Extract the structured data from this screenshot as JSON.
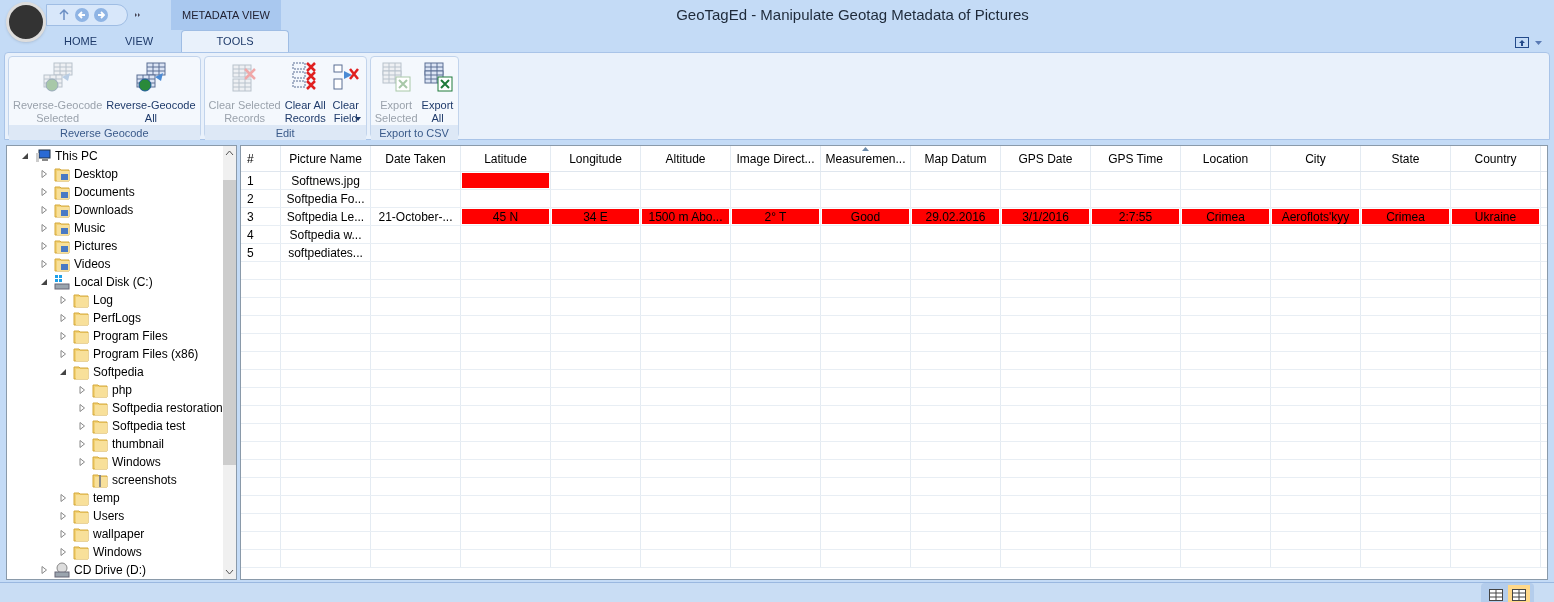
{
  "window": {
    "title": "GeoTagEd - Manipulate Geotag Metadata of Pictures",
    "context_tab": "METADATA VIEW"
  },
  "tabs": [
    {
      "label": "HOME",
      "selected": false
    },
    {
      "label": "VIEW",
      "selected": false
    },
    {
      "label": "TOOLS",
      "selected": true
    }
  ],
  "ribbon_groups": [
    {
      "label": "Reverse Geocode",
      "buttons": [
        {
          "label": "Reverse-Geocode\nSelected",
          "kind": "geocode",
          "disabled": true
        },
        {
          "label": "Reverse-Geocode\nAll",
          "kind": "geocode",
          "disabled": false
        }
      ]
    },
    {
      "label": "Edit",
      "buttons": [
        {
          "label": "Clear Selected\nRecords",
          "kind": "clear-one",
          "disabled": true
        },
        {
          "label": "Clear All\nRecords",
          "kind": "clear-all",
          "disabled": false
        },
        {
          "label": "Clear\nField",
          "kind": "clear-field",
          "disabled": false,
          "dropdown": true
        }
      ]
    },
    {
      "label": "Export to CSV",
      "buttons": [
        {
          "label": "Export\nSelected",
          "kind": "export",
          "disabled": true
        },
        {
          "label": "Export\nAll",
          "kind": "export",
          "disabled": false
        }
      ]
    }
  ],
  "tree": [
    {
      "label": "This PC",
      "kind": "pc",
      "expanded": true,
      "children": [
        {
          "label": "Desktop",
          "kind": "special",
          "expanded": false
        },
        {
          "label": "Documents",
          "kind": "special",
          "expanded": false
        },
        {
          "label": "Downloads",
          "kind": "special",
          "expanded": false
        },
        {
          "label": "Music",
          "kind": "special",
          "expanded": false
        },
        {
          "label": "Pictures",
          "kind": "special",
          "expanded": false
        },
        {
          "label": "Videos",
          "kind": "special",
          "expanded": false
        },
        {
          "label": "Local Disk (C:)",
          "kind": "drive",
          "expanded": true,
          "children": [
            {
              "label": "Log",
              "kind": "folder",
              "expanded": false
            },
            {
              "label": "PerfLogs",
              "kind": "folder",
              "expanded": false
            },
            {
              "label": "Program Files",
              "kind": "folder",
              "expanded": false
            },
            {
              "label": "Program Files (x86)",
              "kind": "folder",
              "expanded": false
            },
            {
              "label": "Softpedia",
              "kind": "folder",
              "expanded": true,
              "children": [
                {
                  "label": "php",
                  "kind": "folder",
                  "expanded": false
                },
                {
                  "label": "Softpedia restoration",
                  "kind": "folder",
                  "expanded": false
                },
                {
                  "label": "Softpedia test",
                  "kind": "folder",
                  "expanded": false
                },
                {
                  "label": "thumbnail",
                  "kind": "folder",
                  "expanded": false
                },
                {
                  "label": "Windows",
                  "kind": "folder",
                  "expanded": false
                },
                {
                  "label": "screenshots",
                  "kind": "zip"
                }
              ]
            },
            {
              "label": "temp",
              "kind": "folder",
              "expanded": false
            },
            {
              "label": "Users",
              "kind": "folder",
              "expanded": false
            },
            {
              "label": "wallpaper",
              "kind": "folder",
              "expanded": false
            },
            {
              "label": "Windows",
              "kind": "folder",
              "expanded": false
            }
          ]
        },
        {
          "label": "CD Drive (D:)",
          "kind": "cd",
          "expanded": false
        }
      ]
    }
  ],
  "table": {
    "columns": [
      {
        "label": "#"
      },
      {
        "label": "Picture Name"
      },
      {
        "label": "Date Taken"
      },
      {
        "label": "Latitude"
      },
      {
        "label": "Longitude"
      },
      {
        "label": "Altitude"
      },
      {
        "label": "Image Direct..."
      },
      {
        "label": "Measuremen...",
        "sorted": true
      },
      {
        "label": "Map Datum"
      },
      {
        "label": "GPS Date"
      },
      {
        "label": "GPS Time"
      },
      {
        "label": "Location"
      },
      {
        "label": "City"
      },
      {
        "label": "State"
      },
      {
        "label": "Country"
      }
    ],
    "rows": [
      {
        "cells": [
          {
            "text": "1"
          },
          {
            "text": "Softnews.jpg"
          },
          {},
          {
            "flagged": true
          },
          {},
          {},
          {},
          {},
          {},
          {},
          {},
          {},
          {},
          {},
          {}
        ]
      },
      {
        "cells": [
          {
            "text": "2"
          },
          {
            "text": "Softpedia Fo..."
          },
          {},
          {},
          {},
          {},
          {},
          {},
          {},
          {},
          {},
          {},
          {},
          {},
          {}
        ]
      },
      {
        "cells": [
          {
            "text": "3"
          },
          {
            "text": "Softpedia Le..."
          },
          {
            "text": "21-October-..."
          },
          {
            "text": "45 N",
            "flagged": true
          },
          {
            "text": "34 E",
            "flagged": true
          },
          {
            "text": "1500 m Abo...",
            "flagged": true
          },
          {
            "text": "2° T",
            "flagged": true
          },
          {
            "text": "Good",
            "flagged": true
          },
          {
            "text": "29.02.2016",
            "flagged": true
          },
          {
            "text": "3/1/2016",
            "flagged": true
          },
          {
            "text": "2:7:55",
            "flagged": true
          },
          {
            "text": "Crimea",
            "flagged": true
          },
          {
            "text": "Aeroflots'kyy",
            "flagged": true
          },
          {
            "text": "Crimea",
            "flagged": true
          },
          {
            "text": "Ukraine",
            "flagged": true
          }
        ]
      },
      {
        "cells": [
          {
            "text": "4"
          },
          {
            "text": "Softpedia w..."
          },
          {},
          {},
          {},
          {},
          {},
          {},
          {},
          {},
          {},
          {},
          {},
          {},
          {}
        ]
      },
      {
        "cells": [
          {
            "text": "5"
          },
          {
            "text": "softpediates..."
          },
          {},
          {},
          {},
          {},
          {},
          {},
          {},
          {},
          {},
          {},
          {},
          {},
          {}
        ]
      }
    ]
  },
  "status_bar": {
    "views": [
      {
        "selected": false
      },
      {
        "selected": true
      }
    ]
  }
}
